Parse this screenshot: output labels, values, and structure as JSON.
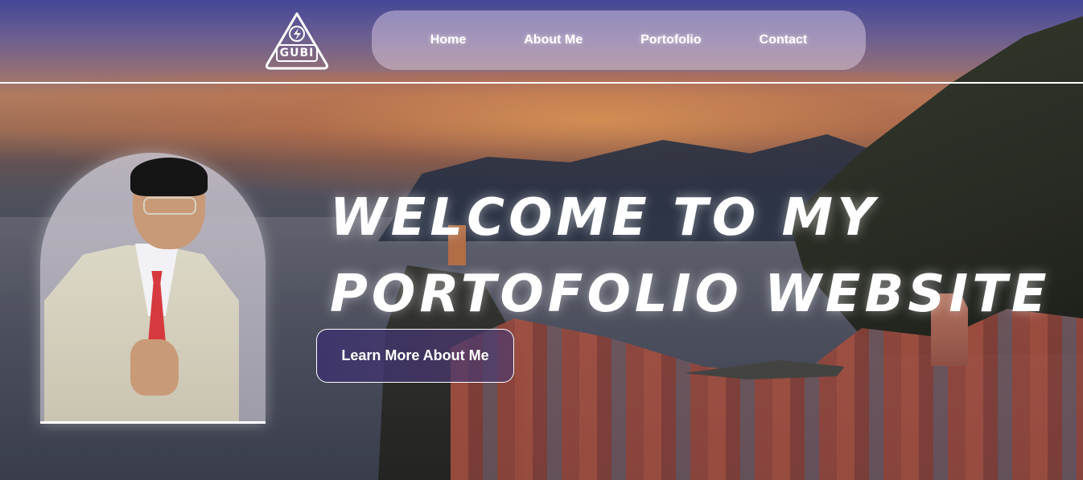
{
  "logo": {
    "text": "GUBI",
    "icon": "triangle-lightning-icon"
  },
  "nav": {
    "items": [
      {
        "label": "Home"
      },
      {
        "label": "About Me"
      },
      {
        "label": "Portofolio"
      },
      {
        "label": "Contact"
      }
    ]
  },
  "hero": {
    "title_line1": "WELCOME TO MY",
    "title_line2": "PORTOFOLIO WEBSITE",
    "cta_label": "Learn More About Me"
  },
  "colors": {
    "text": "#ffffff",
    "nav_bg": "rgba(230,215,235,0.45)",
    "tie": "#d63a3e"
  }
}
